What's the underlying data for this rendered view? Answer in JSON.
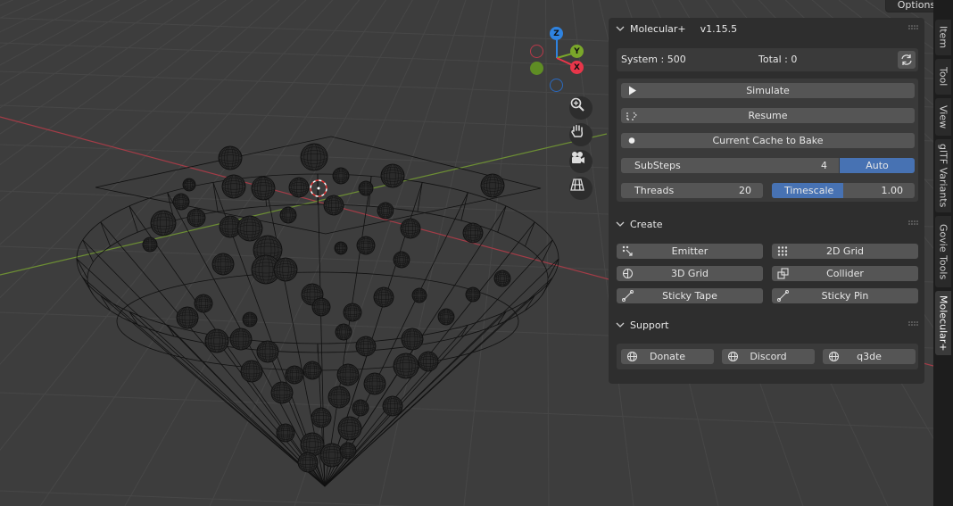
{
  "header": {
    "options_label": "Options"
  },
  "gizmo": {
    "z": "Z",
    "y": "Y",
    "x": "X"
  },
  "colors": {
    "accent": "#4772b3",
    "x_axis": "#e8364a",
    "y_axis": "#7aa72a",
    "z_axis": "#2f83e0"
  },
  "navigation": [
    "zoom-icon",
    "hand-icon",
    "camera-icon",
    "grid-icon"
  ],
  "molecular": {
    "title": "Molecular+",
    "version": "v1.15.5",
    "system": "System : 500",
    "total": "Total : 0",
    "simulate": "Simulate",
    "resume": "Resume",
    "cache": "Current Cache to Bake",
    "substeps_label": "SubSteps",
    "substeps_value": "4",
    "auto": "Auto",
    "threads_label": "Threads",
    "threads_value": "20",
    "timescale_label": "Timescale",
    "timescale_value": "1.00",
    "timescale_fill": 0.5
  },
  "create": {
    "title": "Create",
    "emitter": "Emitter",
    "grid2d": "2D Grid",
    "grid3d": "3D Grid",
    "collider": "Collider",
    "sticky_tape": "Sticky Tape",
    "sticky_pin": "Sticky Pin"
  },
  "support": {
    "title": "Support",
    "donate": "Donate",
    "discord": "Discord",
    "q3de": "q3de"
  },
  "tabs": [
    "Item",
    "Tool",
    "View",
    "glTF Variants",
    "Govie Tools",
    "Molecular+"
  ]
}
